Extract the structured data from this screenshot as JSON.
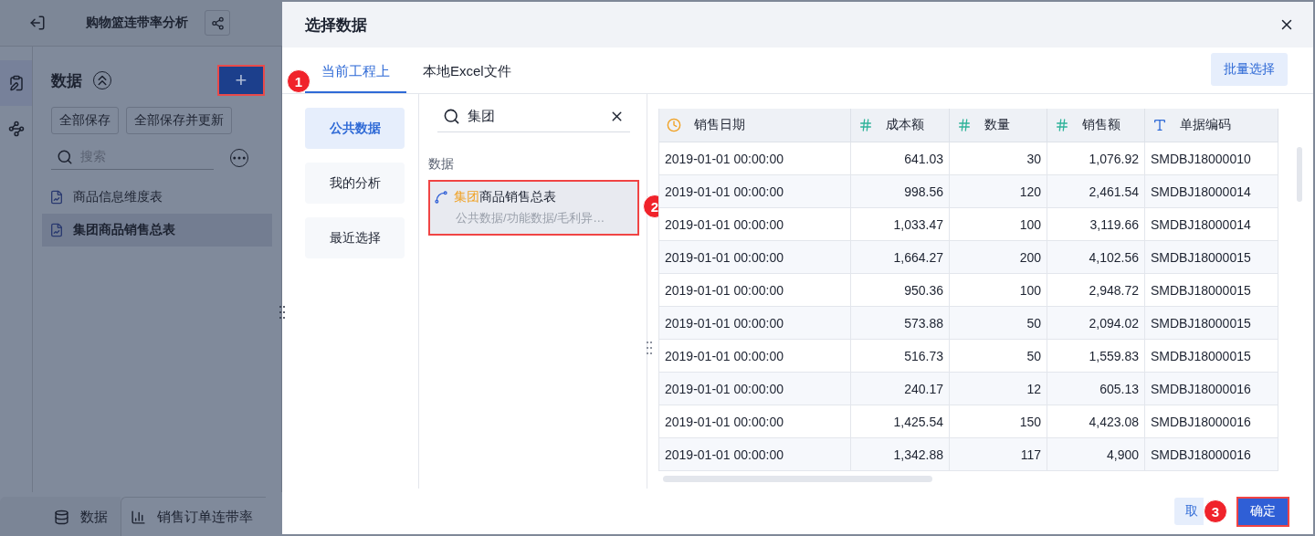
{
  "app": {
    "title": "购物篮连带率分析",
    "panel_title": "数据",
    "add_button": "+",
    "save_all": "全部保存",
    "save_update": "全部保存并更新",
    "search": {
      "placeholder": "搜索"
    },
    "tables": [
      {
        "name": "商品信息维度表",
        "selected": false
      },
      {
        "name": "集团商品销售总表",
        "selected": true
      }
    ],
    "bottom_tabs": [
      {
        "label": "数据",
        "kind": "data",
        "selected": true
      },
      {
        "label": "销售订单连带率",
        "kind": "chart",
        "selected": false
      }
    ]
  },
  "dialog": {
    "title": "选择数据",
    "tabs": [
      {
        "label": "当前工程上",
        "selected": true
      },
      {
        "label": "本地Excel文件",
        "selected": false
      }
    ],
    "batch_button": "批量选择",
    "nav": [
      {
        "label": "公共数据",
        "selected": true
      },
      {
        "label": "我的分析",
        "selected": false
      },
      {
        "label": "最近选择",
        "selected": false
      }
    ],
    "search": {
      "value": "集团"
    },
    "section": "数据",
    "result": {
      "name": "**集团**商品销售总表",
      "path": "公共数据/功能数据/毛利异…",
      "selected": true
    },
    "table": {
      "columns": [
        {
          "label": "销售日期",
          "kind": "date"
        },
        {
          "label": "成本额",
          "kind": "number"
        },
        {
          "label": "数量",
          "kind": "number"
        },
        {
          "label": "销售额",
          "kind": "number"
        },
        {
          "label": "单据编码",
          "kind": "text"
        }
      ],
      "rows": [
        [
          "2019-01-01 00:00:00",
          "641.03",
          "30",
          "1,076.92",
          "SMDBJ18000010"
        ],
        [
          "2019-01-01 00:00:00",
          "998.56",
          "120",
          "2,461.54",
          "SMDBJ18000014"
        ],
        [
          "2019-01-01 00:00:00",
          "1,033.47",
          "100",
          "3,119.66",
          "SMDBJ18000014"
        ],
        [
          "2019-01-01 00:00:00",
          "1,664.27",
          "200",
          "4,102.56",
          "SMDBJ18000015"
        ],
        [
          "2019-01-01 00:00:00",
          "950.36",
          "100",
          "2,948.72",
          "SMDBJ18000015"
        ],
        [
          "2019-01-01 00:00:00",
          "573.88",
          "50",
          "2,094.02",
          "SMDBJ18000015"
        ],
        [
          "2019-01-01 00:00:00",
          "516.73",
          "50",
          "1,559.83",
          "SMDBJ18000015"
        ],
        [
          "2019-01-01 00:00:00",
          "240.17",
          "12",
          "605.13",
          "SMDBJ18000016"
        ],
        [
          "2019-01-01 00:00:00",
          "1,425.54",
          "150",
          "4,423.08",
          "SMDBJ18000016"
        ],
        [
          "2019-01-01 00:00:00",
          "1,342.88",
          "117",
          "4,900",
          "SMDBJ18000016"
        ]
      ]
    },
    "cancel_button": "取",
    "ok_button": "确定"
  },
  "badges": [
    "1",
    "2",
    "3"
  ]
}
